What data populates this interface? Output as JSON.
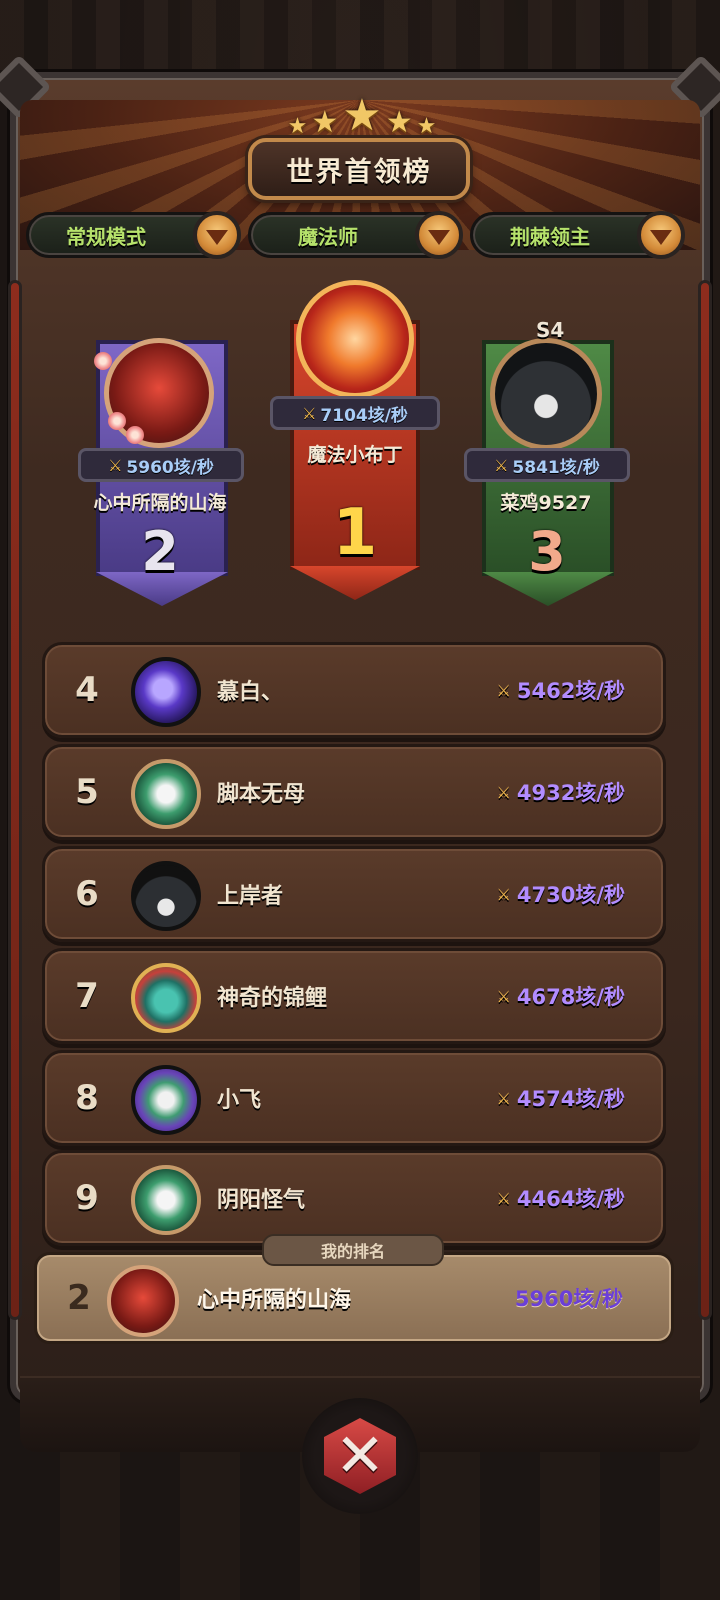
{
  "title": "世界首领榜",
  "tabs": [
    {
      "label": "常规模式"
    },
    {
      "label": "魔法师"
    },
    {
      "label": "荆棘领主"
    }
  ],
  "podium": {
    "first": {
      "name": "魔法小布丁",
      "score": "7104垓/秒",
      "rank": "1"
    },
    "second": {
      "name": "心中所隔的山海",
      "score": "5960垓/秒",
      "rank": "2"
    },
    "third": {
      "name": "菜鸡9527",
      "score": "5841垓/秒",
      "rank": "3",
      "badge": "S4"
    }
  },
  "rows": [
    {
      "rank": "4",
      "name": "慕白、",
      "score": "5462垓/秒"
    },
    {
      "rank": "5",
      "name": "脚本无母",
      "score": "4932垓/秒"
    },
    {
      "rank": "6",
      "name": "上岸者",
      "score": "4730垓/秒"
    },
    {
      "rank": "7",
      "name": "神奇的锦鲤",
      "score": "4678垓/秒"
    },
    {
      "rank": "8",
      "name": "小飞",
      "score": "4574垓/秒"
    },
    {
      "rank": "9",
      "name": "阴阳怪气",
      "score": "4464垓/秒"
    }
  ],
  "my_rank": {
    "label": "我的排名",
    "rank": "2",
    "name": "心中所隔的山海",
    "score": "5960垓/秒"
  },
  "icons": {
    "swords": "crossed-swords-icon",
    "dropdown": "triangle-down-icon",
    "close": "close-x-icon",
    "star": "star-icon"
  },
  "colors": {
    "score_purple": "#b28cff",
    "tab_green": "#b6e26b",
    "gold": "#ffd54a"
  }
}
